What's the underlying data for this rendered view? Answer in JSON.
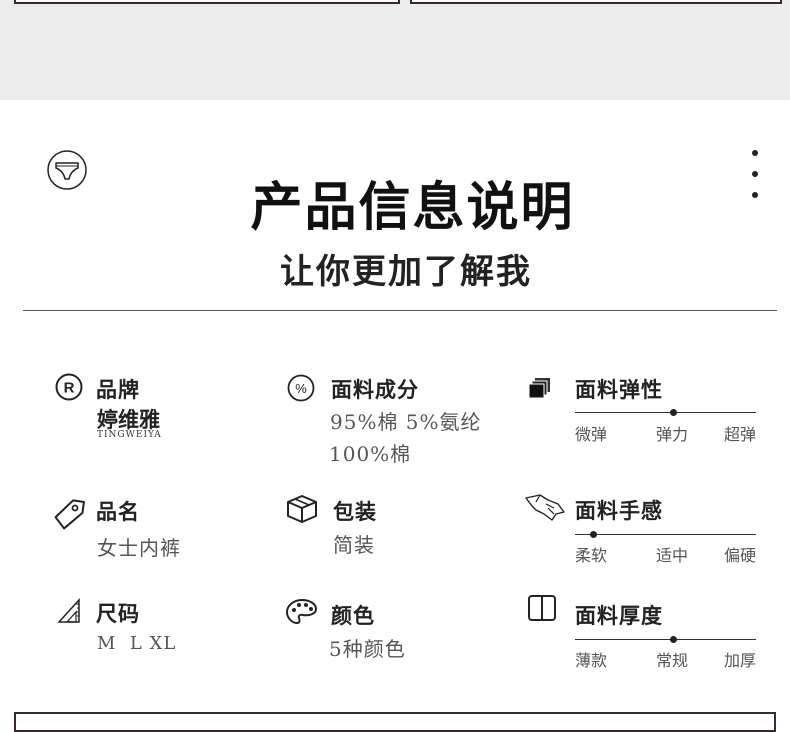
{
  "header": {
    "title": "产品信息说明",
    "subtitle": "让你更加了解我"
  },
  "specs": {
    "brand": {
      "label": "品牌",
      "value": "婷维雅",
      "value_en": "TINGWEIYA"
    },
    "fabric_composition": {
      "label": "面料成分",
      "lines": [
        "95%棉 5%氨纶",
        "100%棉"
      ]
    },
    "product_name": {
      "label": "品名",
      "value": "女士内裤"
    },
    "packaging": {
      "label": "包装",
      "value": "简装"
    },
    "size": {
      "label": "尺码",
      "value": "M  L XL"
    },
    "color": {
      "label": "颜色",
      "value": "5种颜色"
    }
  },
  "scales": {
    "elasticity": {
      "label": "面料弹性",
      "ticks": [
        "微弹",
        "弹力",
        "超弹"
      ],
      "level": 0.54
    },
    "hand_feel": {
      "label": "面料手感",
      "ticks": [
        "柔软",
        "适中",
        "偏硬"
      ],
      "level": 0.1
    },
    "thickness": {
      "label": "面料厚度",
      "ticks": [
        "薄款",
        "常规",
        "加厚"
      ],
      "level": 0.54
    }
  },
  "icons": [
    "underwear-icon",
    "more-icon",
    "registered-icon",
    "percent-icon",
    "fabric-layers-icon",
    "tag-icon",
    "box-icon",
    "hand-feel-icon",
    "ruler-icon",
    "palette-icon",
    "book-icon"
  ],
  "colors": {
    "background": "#ffffff",
    "band": "#ececec",
    "text": "#222222",
    "muted": "#555555"
  }
}
